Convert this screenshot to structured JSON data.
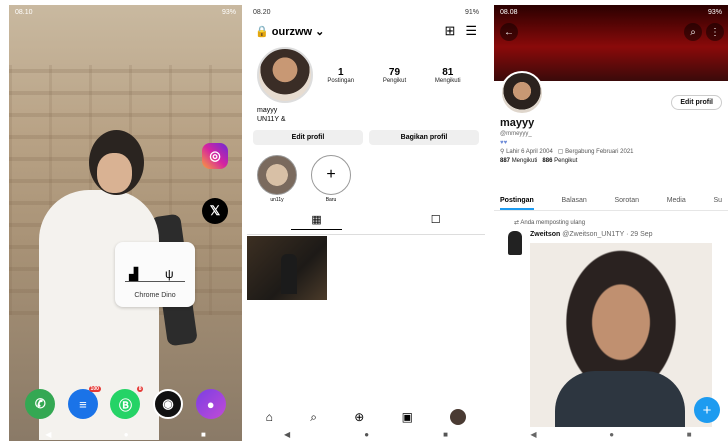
{
  "phone1": {
    "status": {
      "time": "08.10",
      "battery": "93%"
    },
    "widget": {
      "label": "Chrome Dino"
    },
    "dock_badges": {
      "messages": "100",
      "whatsapp": "8"
    },
    "nav": {
      "back": "◀",
      "home": "●",
      "recents": "■"
    },
    "colors": {
      "instagram": "#d6249f",
      "x": "#000000",
      "phone": "#34a853"
    }
  },
  "phone2": {
    "status": {
      "time": "08.20",
      "battery": "91%"
    },
    "username": "ourzww",
    "stats": [
      {
        "num": "1",
        "label": "Postingan"
      },
      {
        "num": "79",
        "label": "Pengikut"
      },
      {
        "num": "81",
        "label": "Mengikuti"
      }
    ],
    "name": "mayyy",
    "bio": "UN11Y &",
    "buttons": {
      "edit": "Edit profil",
      "share": "Bagikan profil"
    },
    "highlights": [
      {
        "label": "un11y"
      },
      {
        "label": "Baru"
      }
    ],
    "nav": {
      "back": "◀",
      "home": "●",
      "recents": "■"
    }
  },
  "phone3": {
    "status": {
      "time": "08.08",
      "battery": "93%"
    },
    "edit_button": "Edit profil",
    "name": "mayyy",
    "handle": "@mmeyyy_",
    "born": "Lahir 6 April 2004",
    "joined": "Bergabung Februari 2021",
    "following_count": "887",
    "following_label": "Mengikuti",
    "followers_count": "886",
    "followers_label": "Pengikut",
    "tabs": [
      "Postingan",
      "Balasan",
      "Sorotan",
      "Media",
      "Su"
    ],
    "repost_label": "Anda memposting ulang",
    "tweet": {
      "author": "Zweitson",
      "handle": "@Zweitson_UN1TY · 29 Sep"
    },
    "nav": {
      "back": "◀",
      "home": "●",
      "recents": "■"
    }
  }
}
